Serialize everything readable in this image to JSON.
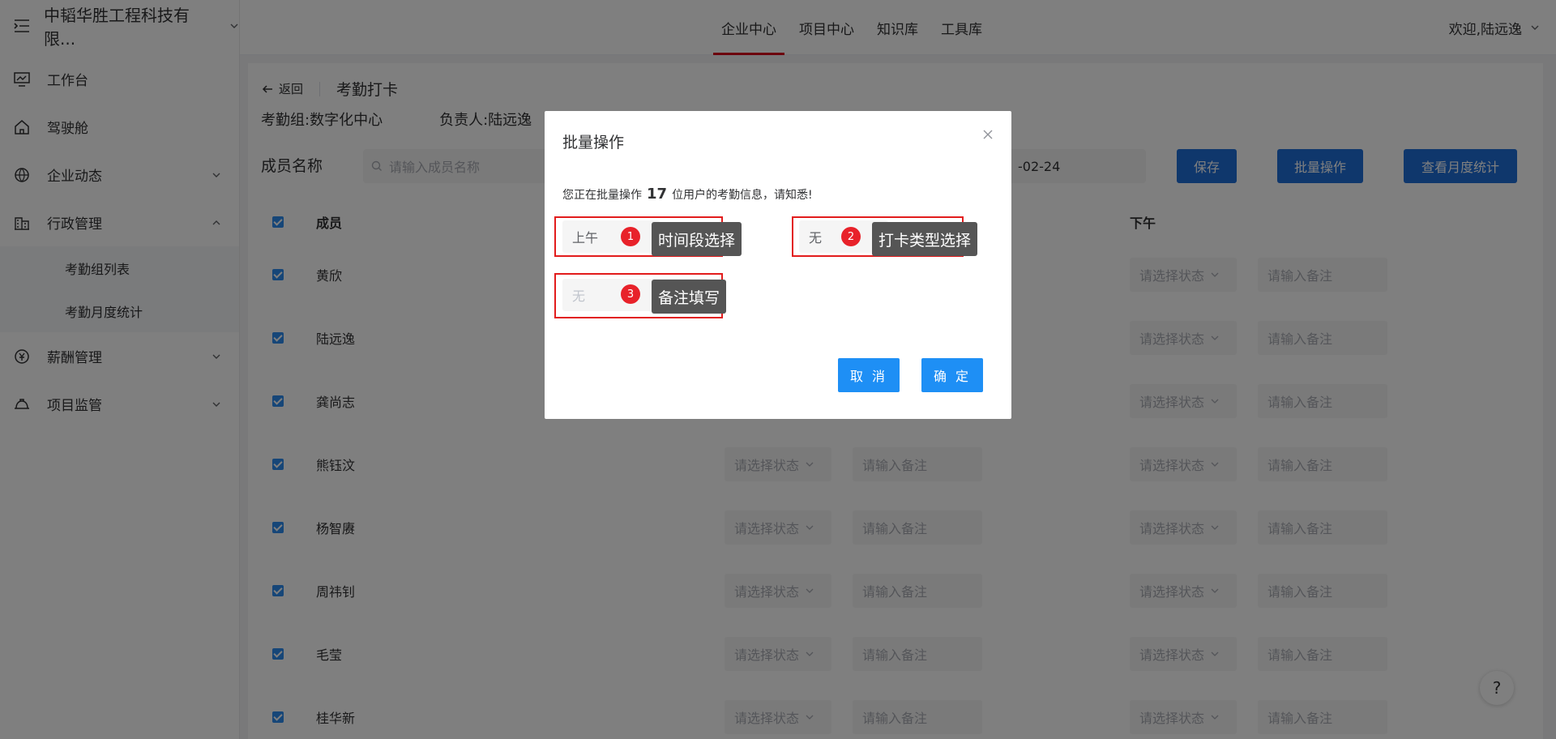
{
  "sidebar": {
    "company": "中韬华胜工程科技有限...",
    "items": [
      {
        "label": "工作台",
        "icon": "monitor-icon"
      },
      {
        "label": "驾驶舱",
        "icon": "home-icon"
      },
      {
        "label": "企业动态",
        "icon": "globe-icon"
      },
      {
        "label": "行政管理",
        "icon": "building-icon"
      },
      {
        "label": "薪酬管理",
        "icon": "salary-icon"
      },
      {
        "label": "项目监管",
        "icon": "helmet-icon"
      }
    ],
    "sub_items": [
      "考勤组列表",
      "考勤月度统计"
    ]
  },
  "header": {
    "tabs": [
      "企业中心",
      "项目中心",
      "知识库",
      "工具库"
    ],
    "active_tab": "企业中心",
    "welcome": "欢迎,陆远逸"
  },
  "page": {
    "back": "返回",
    "title": "考勤打卡",
    "group": "考勤组:数字化中心",
    "owner": "负责人:陆远逸",
    "filter_label": "成员名称",
    "search_placeholder": "请输入成员名称",
    "date_value": "-02-24",
    "buttons": {
      "save": "保存",
      "batch": "批量操作",
      "monthly": "查看月度统计"
    }
  },
  "table": {
    "col_member": "成员",
    "col_afternoon": "下午",
    "select_placeholder": "请选择状态",
    "note_placeholder": "请输入备注",
    "members": [
      "黄欣",
      "陆远逸",
      "龚尚志",
      "熊钰汶",
      "杨智赓",
      "周祎钊",
      "毛莹",
      "桂华新"
    ]
  },
  "dialog": {
    "title": "批量操作",
    "msg_prefix": "您正在批量操作",
    "count": "17",
    "msg_suffix": "位用户的考勤信息，请知悉!",
    "period_value": "上午",
    "type_value": "无",
    "note_placeholder": "无",
    "cancel": "取 消",
    "confirm": "确 定"
  },
  "annotations": [
    {
      "num": "1",
      "text": "时间段选择"
    },
    {
      "num": "2",
      "text": "打卡类型选择"
    },
    {
      "num": "3",
      "text": "备注填写"
    }
  ],
  "help": "?"
}
